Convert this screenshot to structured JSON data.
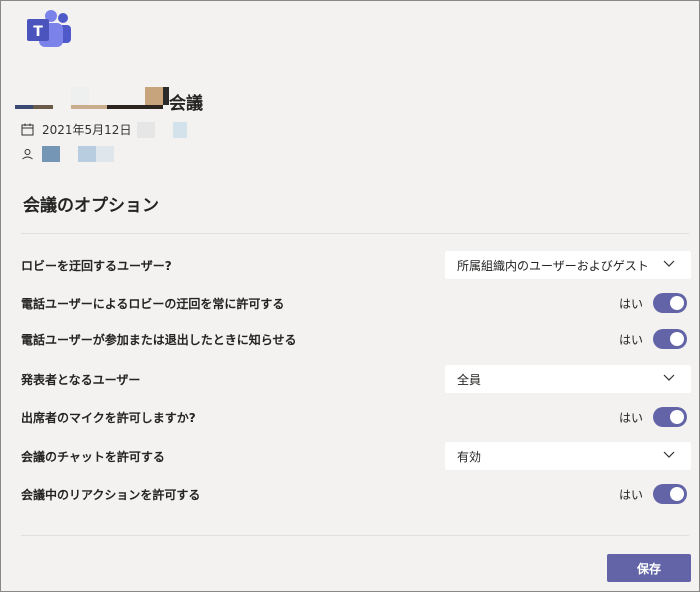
{
  "app": {
    "logo_letter": "T"
  },
  "meeting": {
    "title_suffix": "会議",
    "date": "2021年5月12日"
  },
  "options": {
    "section_title": "会議のオプション",
    "rows": [
      {
        "label": "ロビーを迂回するユーザー?",
        "control": "select",
        "value": "所属組織内のユーザーおよびゲスト"
      },
      {
        "label": "電話ユーザーによるロビーの迂回を常に許可する",
        "control": "toggle",
        "value": "はい"
      },
      {
        "label": "電話ユーザーが参加または退出したときに知らせる",
        "control": "toggle",
        "value": "はい"
      },
      {
        "label": "発表者となるユーザー",
        "control": "select",
        "value": "全員"
      },
      {
        "label": "出席者のマイクを許可しますか?",
        "control": "toggle",
        "value": "はい"
      },
      {
        "label": "会議のチャットを許可する",
        "control": "select",
        "value": "有効"
      },
      {
        "label": "会議中のリアクションを許可する",
        "control": "toggle",
        "value": "はい"
      }
    ]
  },
  "footer": {
    "save_label": "保存"
  },
  "colors": {
    "accent": "#6264a7",
    "background": "#f3f2f1"
  }
}
